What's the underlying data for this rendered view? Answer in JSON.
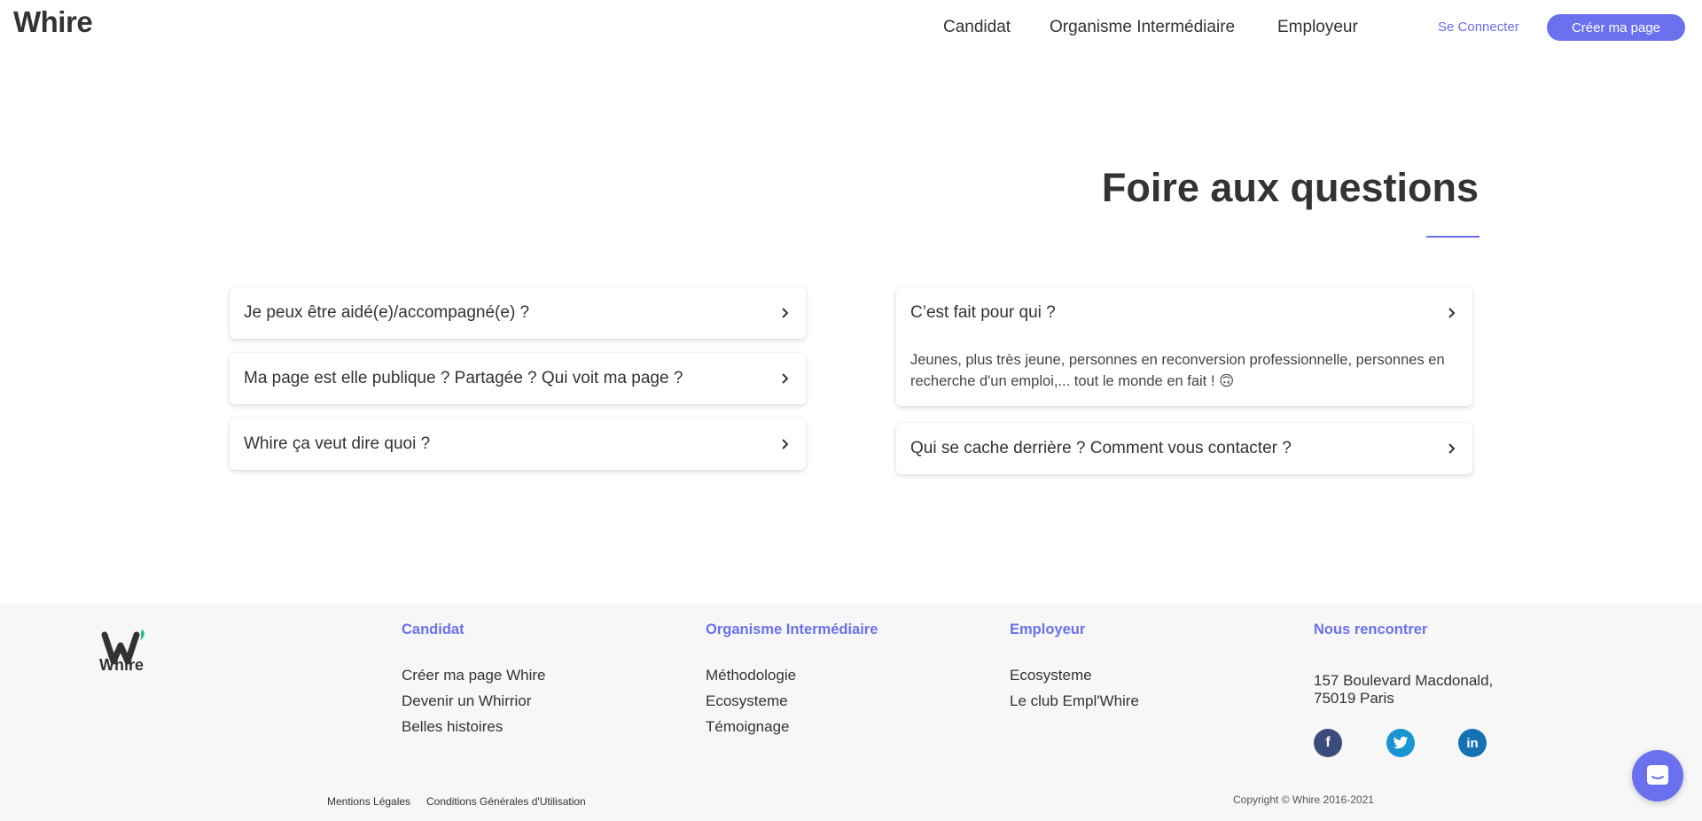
{
  "header": {
    "logo": "Whire",
    "nav": [
      "Candidat",
      "Organisme Intermédiaire",
      "Employeur"
    ],
    "login": "Se Connecter",
    "cta": "Créer ma page"
  },
  "faq": {
    "title": "Foire aux questions",
    "left": [
      {
        "question": "Je peux être aidé(e)/accompagné(e) ?"
      },
      {
        "question": "Ma page est elle publique ? Partagée ? Qui voit ma page ?"
      },
      {
        "question": "Whire ça veut dire quoi ?"
      }
    ],
    "right": [
      {
        "question": "C’est fait pour qui ?",
        "answer": "Jeunes, plus très jeune, personnes en reconversion professionnelle, personnes en recherche d'un emploi,... tout le monde en fait ! 🙃"
      },
      {
        "question": "Qui se cache derrière ? Comment vous contacter ?"
      }
    ]
  },
  "footer": {
    "logo_text": "Whire",
    "columns": [
      {
        "title": "Candidat",
        "links": [
          "Créer ma page Whire",
          "Devenir un Whirrior",
          "Belles histoires"
        ]
      },
      {
        "title": "Organisme Intermédiaire",
        "links": [
          "Méthodologie",
          "Ecosysteme",
          "Témoignage"
        ]
      },
      {
        "title": "Employeur",
        "links": [
          "Ecosysteme",
          "Le club Empl'Whire"
        ]
      },
      {
        "title": "Nous rencontrer",
        "address_line1": "157 Boulevard Macdonald,",
        "address_line2": "75019 Paris"
      }
    ],
    "social": [
      "facebook-icon",
      "twitter-icon",
      "linkedin-icon"
    ],
    "legal": [
      "Mentions Légales",
      "Conditions Générales d'Utilisation"
    ],
    "copyright": "Copyright © Whire 2016-2021"
  },
  "colors": {
    "accent": "#6b70ee",
    "text": "#333333",
    "footer_bg": "#f7f7f7"
  }
}
